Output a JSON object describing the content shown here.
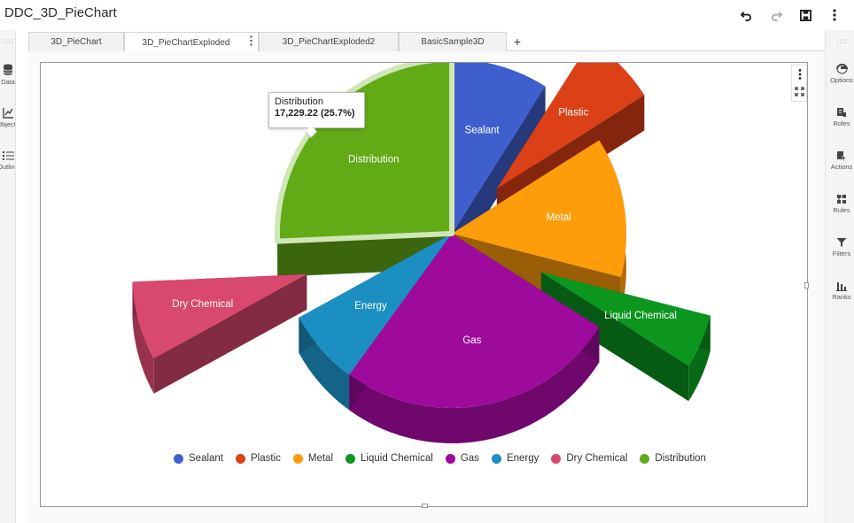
{
  "app": {
    "title": "DDC_3D_PieChart"
  },
  "toolbar": {
    "undo_icon": "undo-icon",
    "redo_icon": "redo-icon",
    "save_icon": "save-icon",
    "more_icon": "more-vertical-icon"
  },
  "left_rail": {
    "grip": "::::",
    "items": [
      {
        "label": "Data",
        "icon": "database-icon"
      },
      {
        "label": "Objects",
        "icon": "line-chart-icon"
      },
      {
        "label": "Outline",
        "icon": "list-icon"
      }
    ]
  },
  "right_rail": {
    "grip": "::::",
    "items": [
      {
        "label": "Options",
        "icon": "options-icon"
      },
      {
        "label": "Roles",
        "icon": "roles-icon"
      },
      {
        "label": "Actions",
        "icon": "actions-icon"
      },
      {
        "label": "Rules",
        "icon": "rules-icon"
      },
      {
        "label": "Filters",
        "icon": "filter-icon"
      },
      {
        "label": "Ranks",
        "icon": "ranks-icon"
      }
    ]
  },
  "tabs": [
    {
      "label": "3D_PieChart",
      "active": false
    },
    {
      "label": "3D_PieChartExploded",
      "active": true
    },
    {
      "label": "3D_PieChartExploded2",
      "active": false
    },
    {
      "label": "BasicSample3D",
      "active": false
    }
  ],
  "add_tab_label": "+",
  "tooltip": {
    "title": "Distribution",
    "value": "17,229.22 (25.7%)"
  },
  "chart_data": {
    "type": "pie",
    "title": "",
    "style": "3d-exploded",
    "categories": [
      "Sealant",
      "Plastic",
      "Metal",
      "Liquid Chemical",
      "Gas",
      "Energy",
      "Dry Chemical",
      "Distribution"
    ],
    "values_percent": [
      9,
      7,
      13,
      5,
      26,
      7,
      7.3,
      25.7
    ],
    "exploded": [
      "Plastic",
      "Liquid Chemical",
      "Dry Chemical"
    ],
    "highlighted": "Distribution",
    "distribution_value": 17229.22,
    "colors": [
      "#3f5fcf",
      "#dc4016",
      "#ff9c0a",
      "#0c9620",
      "#9e0a9c",
      "#1c8fc2",
      "#d9486f",
      "#62aa16"
    ],
    "legend_position": "bottom"
  }
}
